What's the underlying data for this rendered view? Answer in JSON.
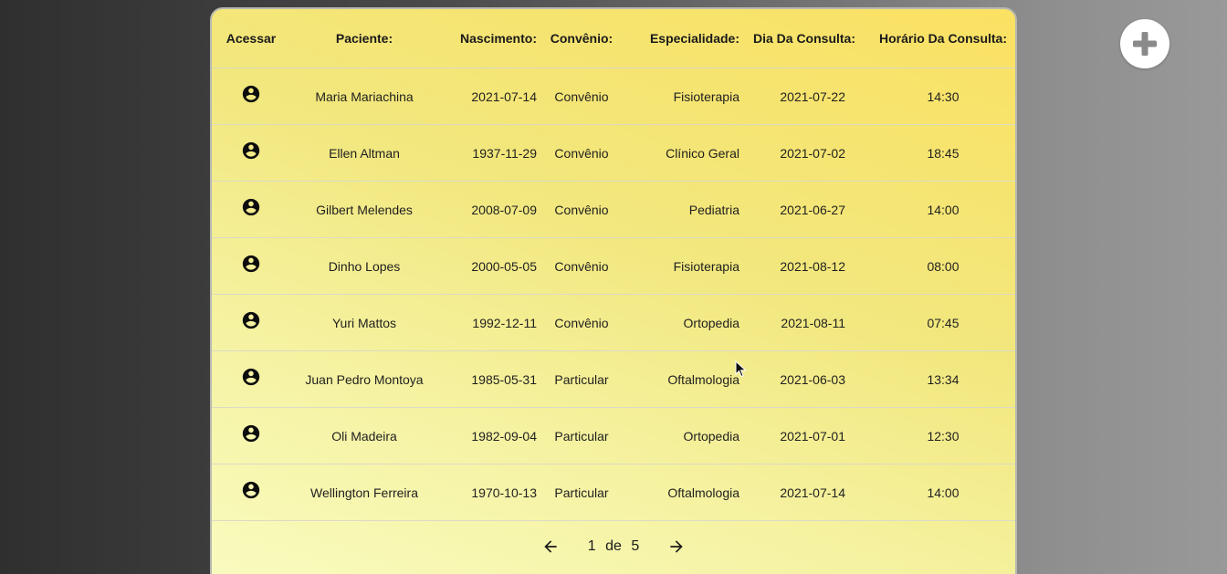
{
  "table": {
    "headers": {
      "acessar": "Acessar",
      "paciente": "Paciente:",
      "nascimento": "Nascimento:",
      "convenio": "Convênio:",
      "especialidade": "Especialidade:",
      "dia": "Dia Da Consulta:",
      "horario": "Horário Da Consulta:"
    },
    "rows": [
      {
        "paciente": "Maria Mariachina",
        "nascimento": "2021-07-14",
        "convenio": "Convênio",
        "especialidade": "Fisioterapia",
        "dia": "2021-07-22",
        "horario": "14:30",
        "icon": "account-circle-icon"
      },
      {
        "paciente": "Ellen Altman",
        "nascimento": "1937-11-29",
        "convenio": "Convênio",
        "especialidade": "Clínico Geral",
        "dia": "2021-07-02",
        "horario": "18:45",
        "icon": "account-circle-icon"
      },
      {
        "paciente": "Gilbert Melendes",
        "nascimento": "2008-07-09",
        "convenio": "Convênio",
        "especialidade": "Pediatria",
        "dia": "2021-06-27",
        "horario": "14:00",
        "icon": "account-circle-icon"
      },
      {
        "paciente": "Dinho Lopes",
        "nascimento": "2000-05-05",
        "convenio": "Convênio",
        "especialidade": "Fisioterapia",
        "dia": "2021-08-12",
        "horario": "08:00",
        "icon": "account-circle-icon"
      },
      {
        "paciente": "Yuri Mattos",
        "nascimento": "1992-12-11",
        "convenio": "Convênio",
        "especialidade": "Ortopedia",
        "dia": "2021-08-11",
        "horario": "07:45",
        "icon": "account-circle-icon"
      },
      {
        "paciente": "Juan Pedro Montoya",
        "nascimento": "1985-05-31",
        "convenio": "Particular",
        "especialidade": "Oftalmologia",
        "dia": "2021-06-03",
        "horario": "13:34",
        "icon": "account-circle-icon"
      },
      {
        "paciente": "Oli Madeira",
        "nascimento": "1982-09-04",
        "convenio": "Particular",
        "especialidade": "Ortopedia",
        "dia": "2021-07-01",
        "horario": "12:30",
        "icon": "account-circle-icon"
      },
      {
        "paciente": "Wellington Ferreira",
        "nascimento": "1970-10-13",
        "convenio": "Particular",
        "especialidade": "Oftalmologia",
        "dia": "2021-07-14",
        "horario": "14:00",
        "icon": "account-circle-icon"
      }
    ]
  },
  "pagination": {
    "current": "1",
    "separator": "de",
    "total": "5",
    "prev_icon": "arrow-left-icon",
    "next_icon": "arrow-right-icon"
  },
  "fab": {
    "icon": "plus-icon"
  },
  "colors": {
    "card_gradient_start": "#f9fcc0",
    "card_gradient_end": "#fbe163",
    "fab_background": "#ffffff",
    "fab_icon": "#8a8a8a"
  }
}
